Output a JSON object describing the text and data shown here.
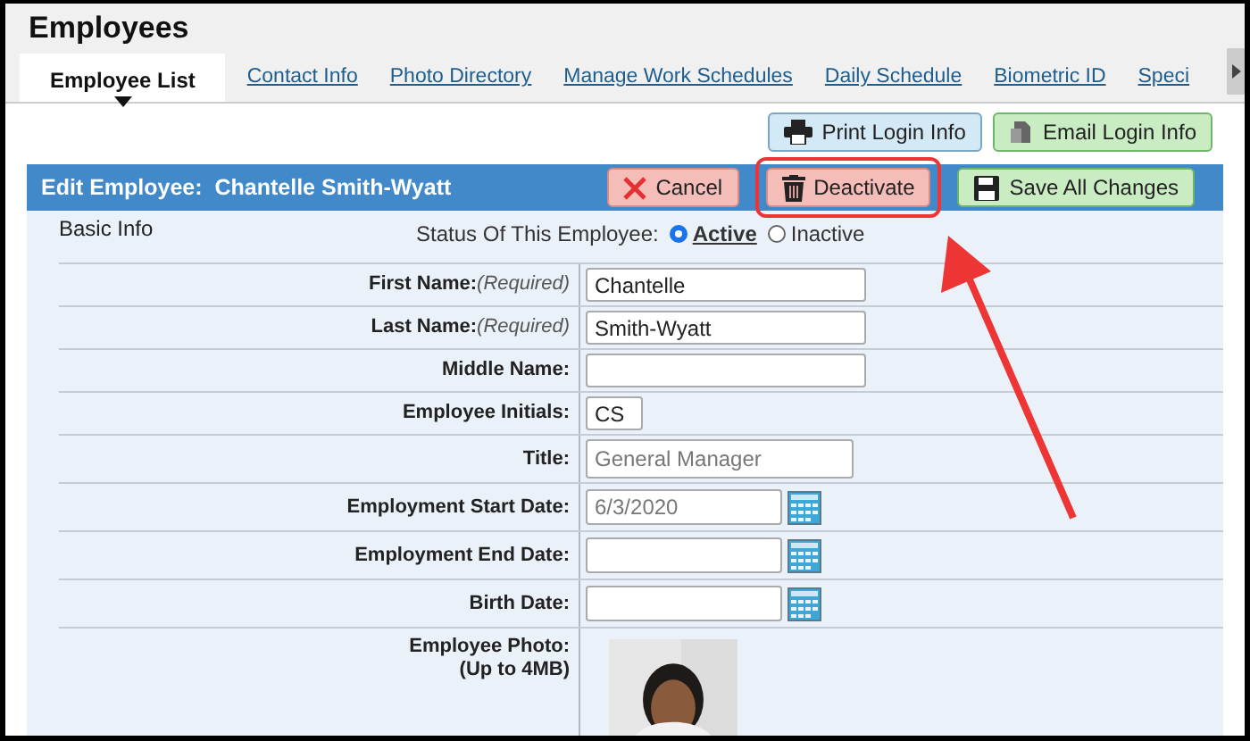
{
  "page": {
    "title": "Employees"
  },
  "tabs": [
    {
      "label": "Employee List",
      "selected": true
    },
    {
      "label": "Contact Info",
      "selected": false
    },
    {
      "label": "Photo Directory",
      "selected": false
    },
    {
      "label": "Manage Work Schedules",
      "selected": false
    },
    {
      "label": "Daily Schedule",
      "selected": false
    },
    {
      "label": "Biometric ID",
      "selected": false
    },
    {
      "label": "Speci",
      "selected": false
    }
  ],
  "top_buttons": [
    {
      "label": "Print Login Info",
      "kind": "print"
    },
    {
      "label": "Email Login Info",
      "kind": "email"
    }
  ],
  "edit_bar": {
    "label": "Edit Employee:",
    "name": "Chantelle Smith-Wyatt",
    "buttons": [
      {
        "label": "Cancel",
        "kind": "cancel",
        "highlighted": false
      },
      {
        "label": "Deactivate",
        "kind": "deactivate",
        "highlighted": true
      },
      {
        "label": "Save All Changes",
        "kind": "save",
        "highlighted": false
      }
    ]
  },
  "section": "Basic Info",
  "status": {
    "label": "Status Of This Employee:",
    "options": [
      {
        "label": "Active",
        "selected": true
      },
      {
        "label": "Inactive",
        "selected": false
      }
    ]
  },
  "fields": [
    {
      "kind": "text",
      "label": "First Name:",
      "note": "(Required)",
      "value": "Chantelle"
    },
    {
      "kind": "text",
      "label": "Last Name:",
      "note": "(Required)",
      "value": "Smith-Wyatt"
    },
    {
      "kind": "text",
      "label": "Middle Name:"
    },
    {
      "kind": "initials",
      "label": "Employee Initials:",
      "value": "CS"
    },
    {
      "kind": "title",
      "label": "Title:",
      "placeholder": "General Manager"
    },
    {
      "kind": "date",
      "label": "Employment Start Date:",
      "placeholder": "6/3/2020"
    },
    {
      "kind": "date",
      "label": "Employment End Date:"
    },
    {
      "kind": "date",
      "label": "Birth Date:"
    },
    {
      "label": "Employee Photo:",
      "note": "(Up to 4MB)"
    }
  ]
}
